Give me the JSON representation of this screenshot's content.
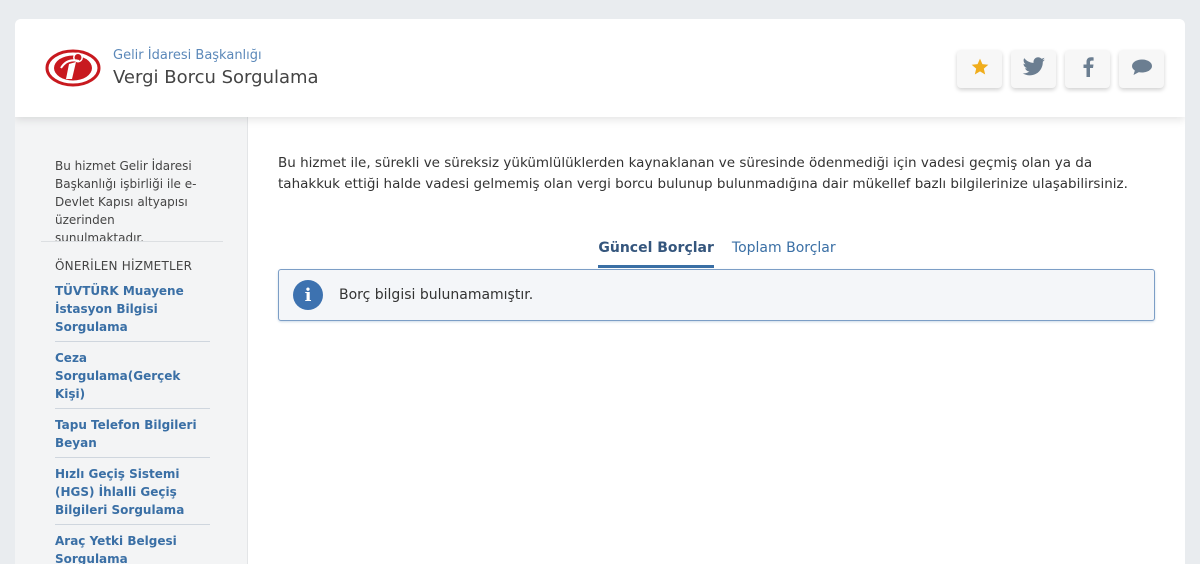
{
  "header": {
    "org_name": "Gelir İdaresi Başkanlığı",
    "service_name": "Vergi Borcu Sorgulama",
    "logo_icon": "gib-logo-icon",
    "actions": [
      {
        "icon": "star-icon",
        "color": "#f0ad1c"
      },
      {
        "icon": "twitter-icon",
        "color": "#6b7e91"
      },
      {
        "icon": "facebook-icon",
        "color": "#6b7e91"
      },
      {
        "icon": "comment-icon",
        "color": "#6b7e91"
      }
    ]
  },
  "sidebar": {
    "intro": "Bu hizmet Gelir İdaresi Başkanlığı işbirliği ile e-Devlet Kapısı altyapısı üzerinden sunulmaktadır.",
    "recommended_title": "ÖNERİLEN HİZMETLER",
    "recommended": [
      "TÜVTÜRK Muayene İstasyon Bilgisi Sorgulama",
      "Ceza Sorgulama(Gerçek Kişi)",
      "Tapu Telefon Bilgileri Beyan",
      "Hızlı Geçiş Sistemi (HGS) İhlalli Geçiş Bilgileri Sorgulama",
      "Araç Yetki Belgesi Sorgulama"
    ]
  },
  "main": {
    "description": "Bu hizmet ile, sürekli ve süreksiz yükümlülüklerden kaynaklanan ve süresinde ödenmediği için vadesi geçmiş olan ya da tahakkuk ettiği halde vadesi gelmemiş olan vergi borcu bulunup bulunmadığına dair mükellef bazlı bilgilerinize ulaşabilirsiniz.",
    "tabs": [
      {
        "label": "Güncel Borçlar",
        "active": true
      },
      {
        "label": "Toplam Borçlar",
        "active": false
      }
    ],
    "alert": {
      "icon": "info-icon",
      "icon_glyph": "i",
      "text": "Borç bilgisi bulunamamıştır."
    }
  },
  "colors": {
    "accent": "#3a6fa5",
    "logo_red": "#c8191f",
    "star": "#f0ad1c"
  }
}
